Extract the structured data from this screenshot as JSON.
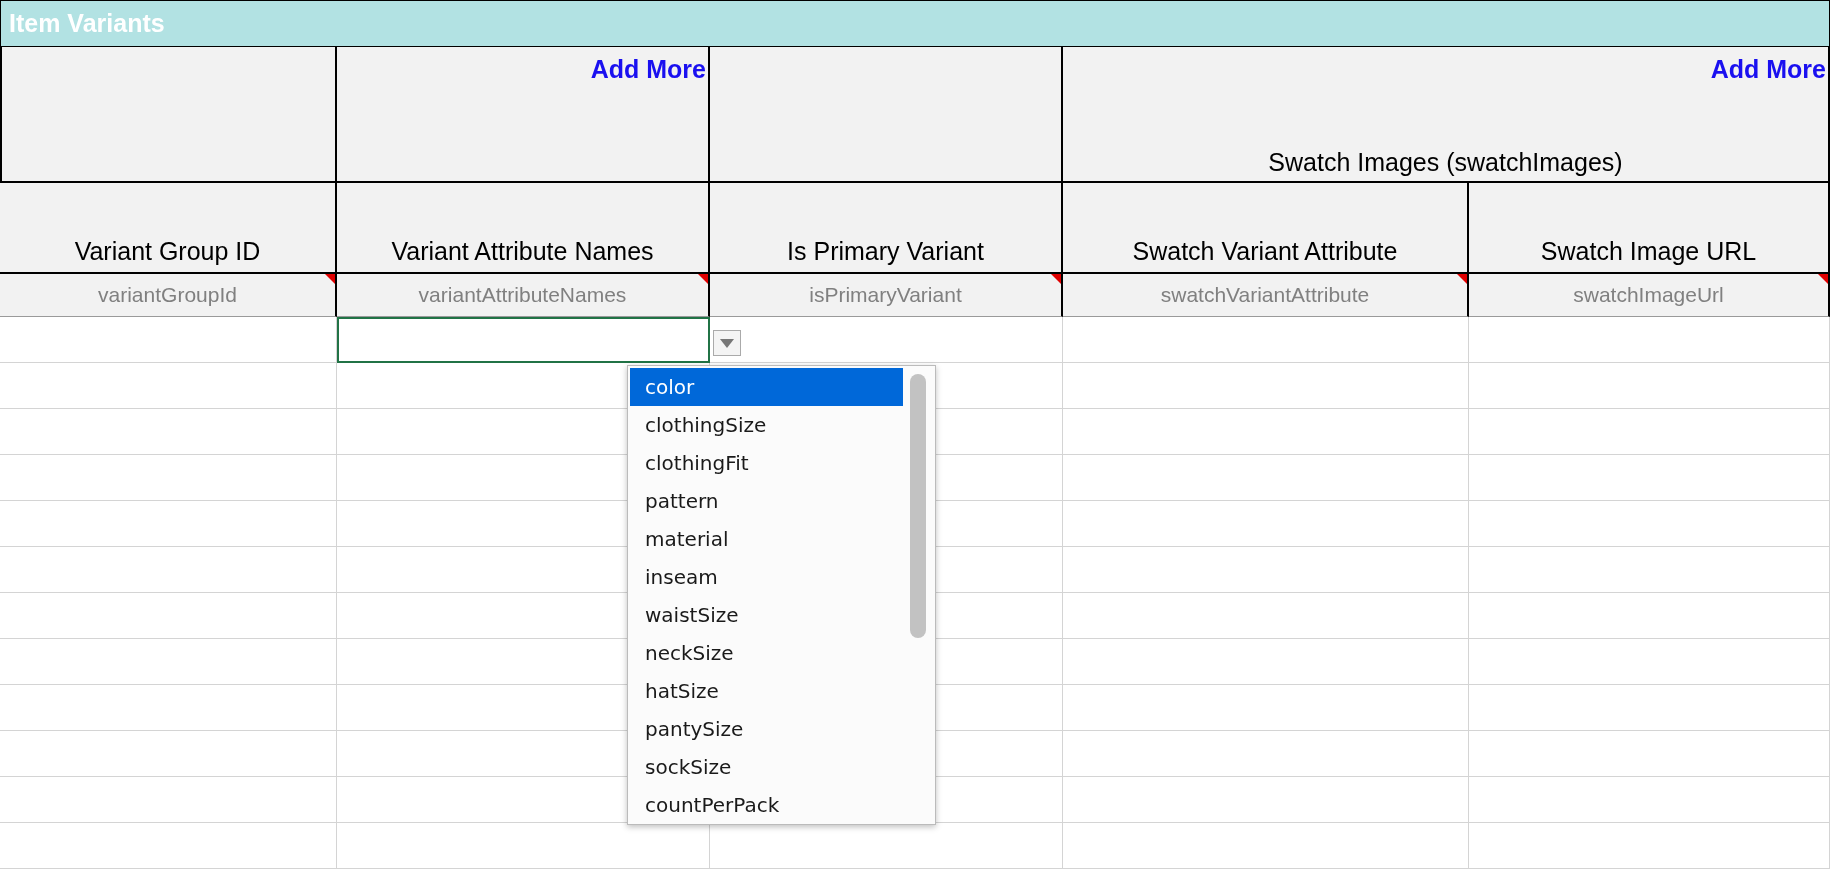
{
  "title": "Item Variants",
  "groups": [
    {
      "columns": [
        {
          "label": "Variant Group ID",
          "key": "variantGroupId",
          "note": true,
          "active": false
        }
      ]
    },
    {
      "add_more": "Add More",
      "columns": [
        {
          "label": "Variant Attribute Names",
          "key": "variantAttributeNames",
          "note": true,
          "active": true
        }
      ]
    },
    {
      "columns": [
        {
          "label": "Is Primary Variant",
          "key": "isPrimaryVariant",
          "note": true,
          "active": false
        }
      ]
    },
    {
      "label": "Swatch Images (swatchImages)",
      "add_more": "Add More",
      "columns": [
        {
          "label": "Swatch Variant Attribute",
          "key": "swatchVariantAttribute",
          "note": true,
          "active": false
        },
        {
          "label": "Swatch Image URL",
          "key": "swatchImageUrl",
          "note": true,
          "active": false
        }
      ]
    }
  ],
  "dropdown": {
    "options": [
      {
        "label": "color",
        "selected": true
      },
      {
        "label": "clothingSize",
        "selected": false
      },
      {
        "label": "clothingFit",
        "selected": false
      },
      {
        "label": "pattern",
        "selected": false
      },
      {
        "label": "material",
        "selected": false
      },
      {
        "label": "inseam",
        "selected": false
      },
      {
        "label": "waistSize",
        "selected": false
      },
      {
        "label": "neckSize",
        "selected": false
      },
      {
        "label": "hatSize",
        "selected": false
      },
      {
        "label": "pantySize",
        "selected": false
      },
      {
        "label": "sockSize",
        "selected": false
      },
      {
        "label": "countPerPack",
        "selected": false
      }
    ]
  }
}
